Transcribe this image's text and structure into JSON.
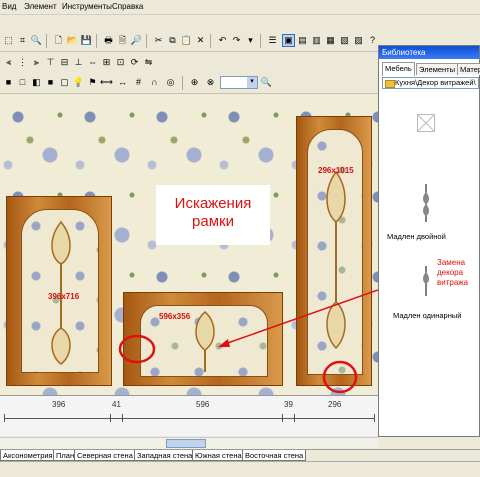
{
  "menu": [
    "Вид",
    "Элемент",
    "Инструменты",
    "Справка"
  ],
  "canvas": {
    "annotation_main": [
      "Искажения",
      "рамки"
    ],
    "dimensions": [
      "396x716",
      "596x356",
      "296x1015"
    ]
  },
  "ruler": {
    "labels": [
      "396",
      "41",
      "596",
      "39",
      "296"
    ]
  },
  "view_tabs": [
    "Аксонометрия",
    "План",
    "Северная стена",
    "Западная стена",
    "Южная стена",
    "Восточная стена"
  ],
  "library": {
    "title": "Библиотека",
    "tabs": [
      "Мебель",
      "Элементы",
      "Матер"
    ],
    "path": "Кухня\\Декор витражей\\",
    "items": [
      {
        "label": "Мадлен двойной"
      },
      {
        "label": "Мадлен одинарный"
      }
    ],
    "annotation": [
      "Замена",
      "декора",
      "витража"
    ]
  },
  "colors": {
    "accent": "#e01010",
    "wood": "#b4661c",
    "titlebar": "#0a4fd6"
  }
}
